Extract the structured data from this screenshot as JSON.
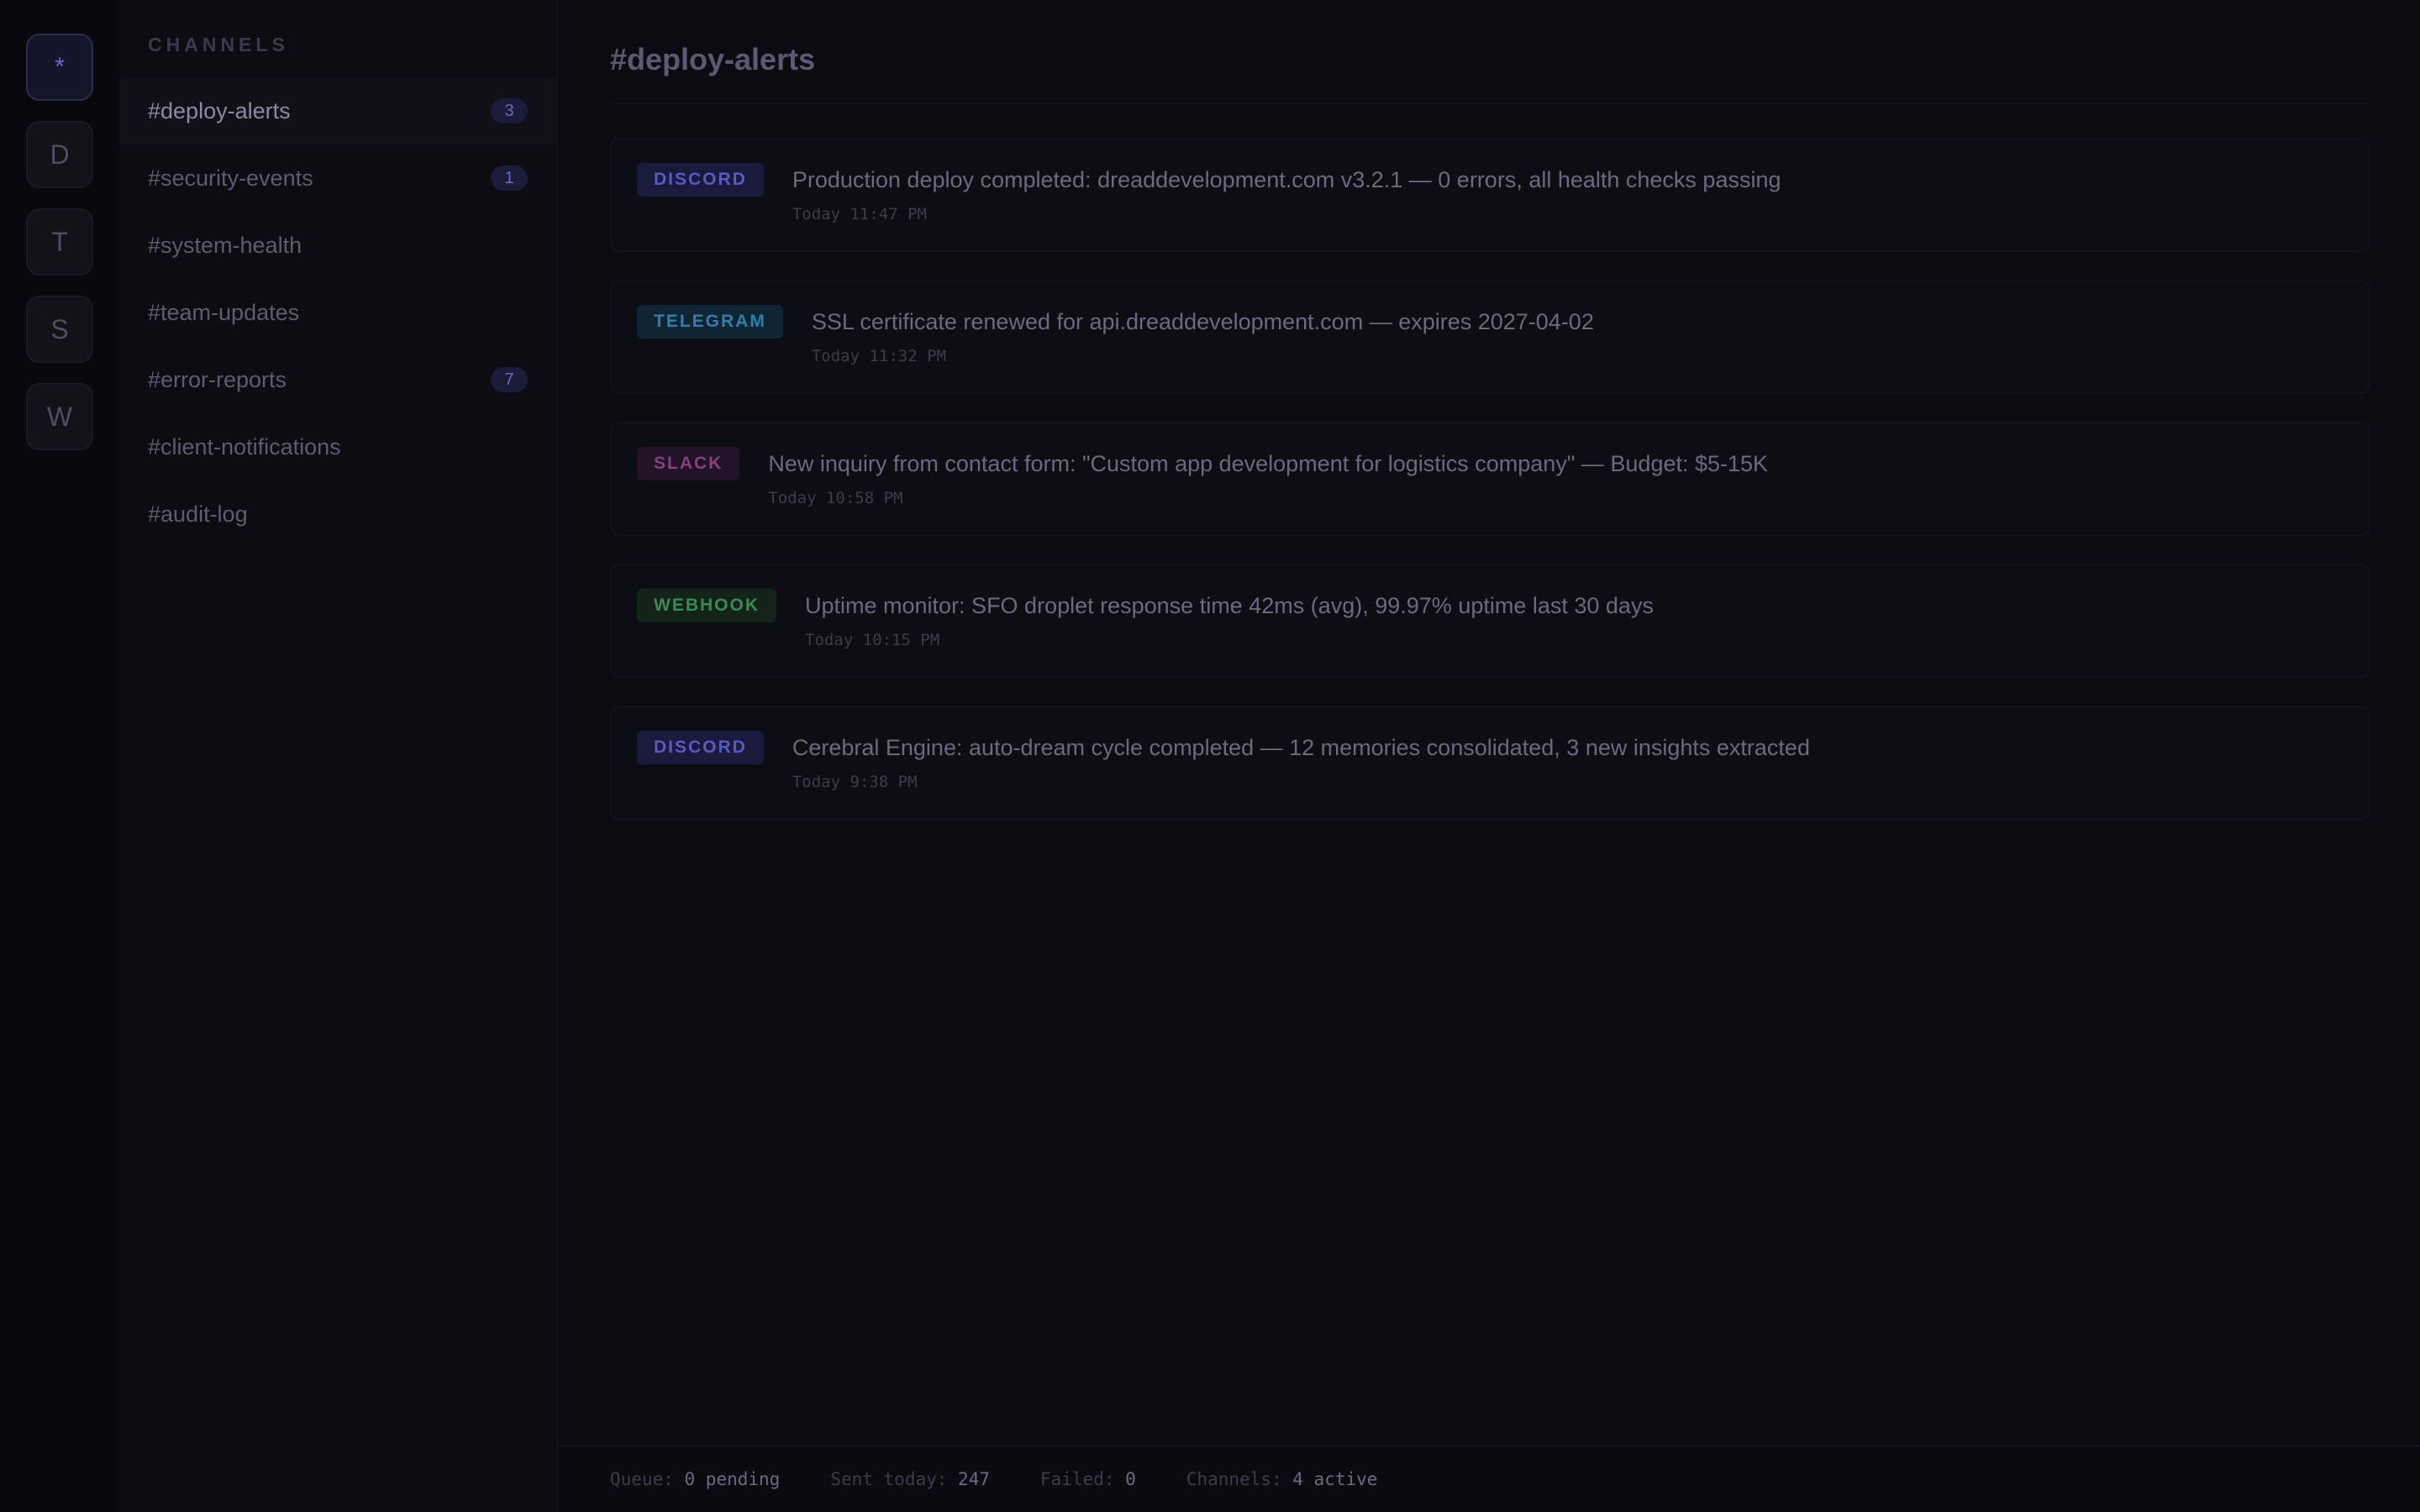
{
  "rail": {
    "items": [
      {
        "label": "*",
        "active": true
      },
      {
        "label": "D",
        "active": false
      },
      {
        "label": "T",
        "active": false
      },
      {
        "label": "S",
        "active": false
      },
      {
        "label": "W",
        "active": false
      }
    ]
  },
  "sidebar": {
    "header": "CHANNELS",
    "channels": [
      {
        "name": "#deploy-alerts",
        "badge": "3",
        "active": true
      },
      {
        "name": "#security-events",
        "badge": "1",
        "active": false
      },
      {
        "name": "#system-health",
        "badge": "",
        "active": false
      },
      {
        "name": "#team-updates",
        "badge": "",
        "active": false
      },
      {
        "name": "#error-reports",
        "badge": "7",
        "active": false
      },
      {
        "name": "#client-notifications",
        "badge": "",
        "active": false
      },
      {
        "name": "#audit-log",
        "badge": "",
        "active": false
      }
    ]
  },
  "main": {
    "title": "#deploy-alerts",
    "messages": [
      {
        "source": "DISCORD",
        "text": "Production deploy completed: dreaddevelopment.com v3.2.1 — 0 errors, all health checks passing",
        "time": "Today 11:47 PM",
        "tag_bg": "#1a1a3c",
        "tag_color": "#5a5ac4"
      },
      {
        "source": "TELEGRAM",
        "text": "SSL certificate renewed for api.dreaddevelopment.com — expires 2027-04-02",
        "time": "Today 11:32 PM",
        "tag_bg": "#112433",
        "tag_color": "#2f7fa8"
      },
      {
        "source": "SLACK",
        "text": "New inquiry from contact form: \"Custom app development for logistics company\" — Budget: $5-15K",
        "time": "Today 10:58 PM",
        "tag_bg": "#221326",
        "tag_color": "#8a3f7e"
      },
      {
        "source": "WEBHOOK",
        "text": "Uptime monitor: SFO droplet response time 42ms (avg), 99.97% uptime last 30 days",
        "time": "Today 10:15 PM",
        "tag_bg": "#14231a",
        "tag_color": "#3c8a52"
      },
      {
        "source": "DISCORD",
        "text": "Cerebral Engine: auto-dream cycle completed — 12 memories consolidated, 3 new insights extracted",
        "time": "Today 9:38 PM",
        "tag_bg": "#1a1a3c",
        "tag_color": "#5a5ac4"
      }
    ]
  },
  "status": {
    "queue_label": "Queue:",
    "queue_value": "0 pending",
    "sent_label": "Sent today:",
    "sent_value": "247",
    "failed_label": "Failed:",
    "failed_value": "0",
    "channels_label": "Channels:",
    "channels_value": "4 active"
  }
}
